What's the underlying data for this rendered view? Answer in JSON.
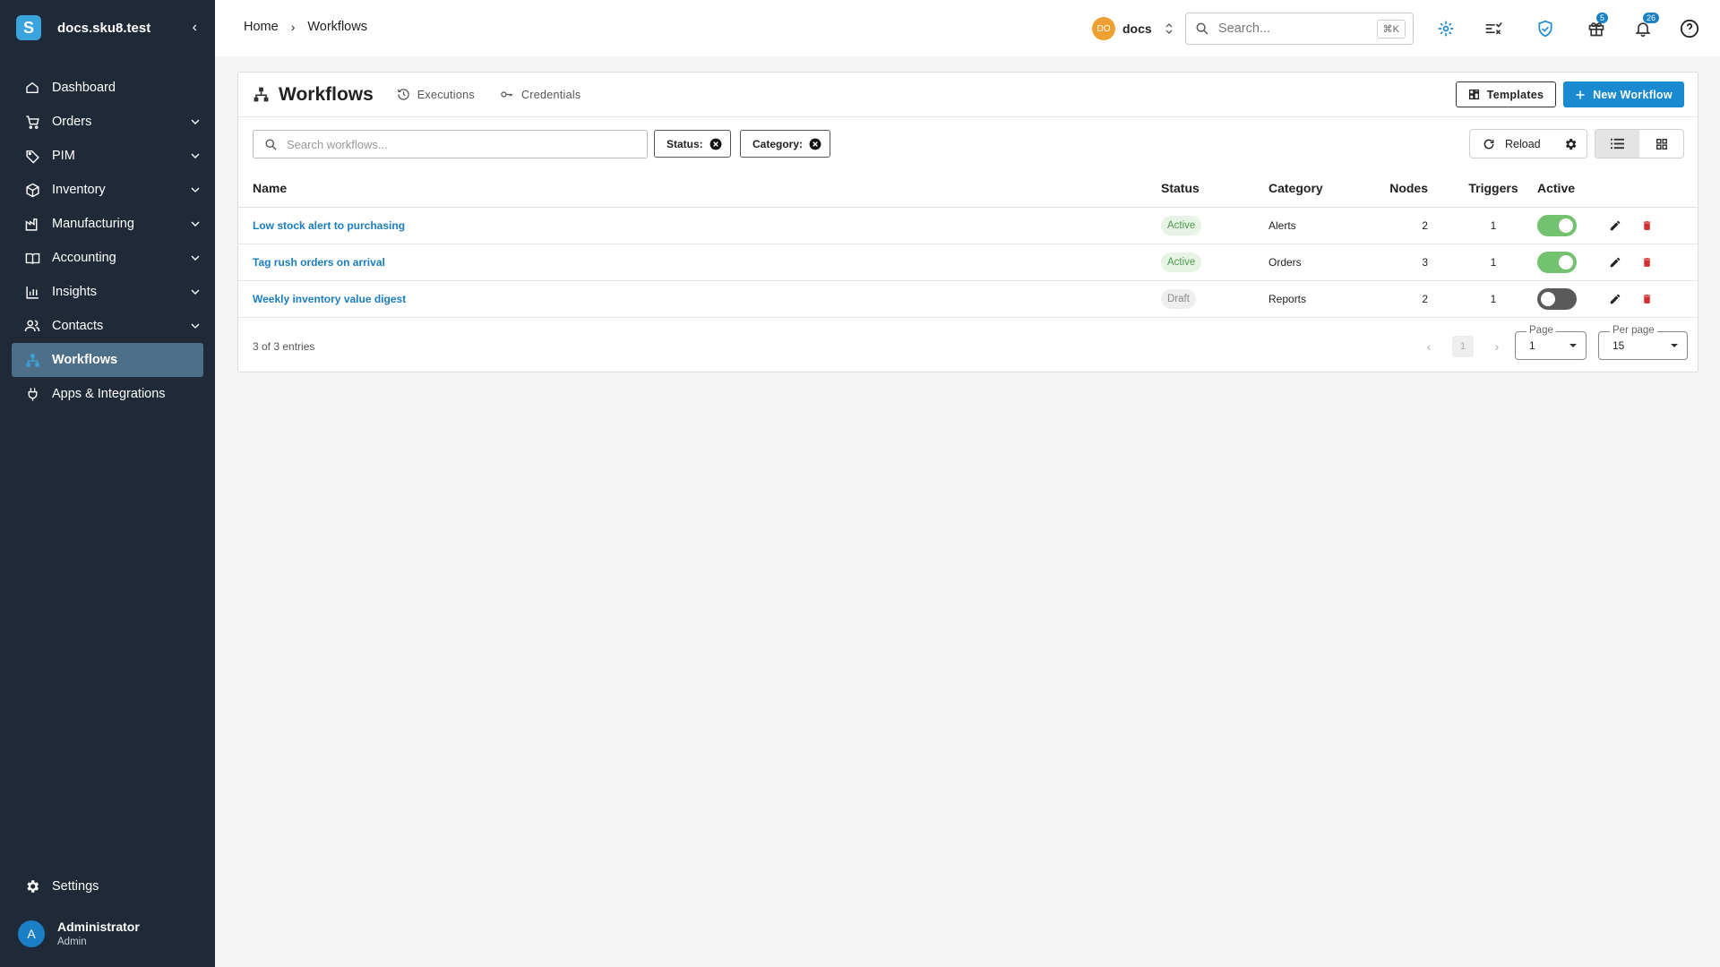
{
  "app": {
    "logo_letter": "S",
    "domain": "docs.sku8.test"
  },
  "sidebar": {
    "items": [
      {
        "label": "Dashboard",
        "icon": "home-icon",
        "expandable": false
      },
      {
        "label": "Orders",
        "icon": "cart-icon",
        "expandable": true
      },
      {
        "label": "PIM",
        "icon": "tag-icon",
        "expandable": true
      },
      {
        "label": "Inventory",
        "icon": "box-icon",
        "expandable": true
      },
      {
        "label": "Manufacturing",
        "icon": "factory-icon",
        "expandable": true
      },
      {
        "label": "Accounting",
        "icon": "book-icon",
        "expandable": true
      },
      {
        "label": "Insights",
        "icon": "bar-chart-icon",
        "expandable": true
      },
      {
        "label": "Contacts",
        "icon": "people-icon",
        "expandable": true
      },
      {
        "label": "Workflows",
        "icon": "workflow-icon",
        "expandable": false,
        "active": true
      },
      {
        "label": "Apps & Integrations",
        "icon": "plug-icon",
        "expandable": false
      }
    ],
    "settings_label": "Settings",
    "user": {
      "initial": "A",
      "name": "Administrator",
      "role": "Admin"
    }
  },
  "topbar": {
    "breadcrumbs": [
      "Home",
      "Workflows"
    ],
    "org": {
      "initials": "DO",
      "name": "docs"
    },
    "search": {
      "placeholder": "Search...",
      "shortcut": "⌘K"
    },
    "gift_count": "5",
    "notification_count": "26"
  },
  "page": {
    "title": "Workflows",
    "tabs": [
      "Executions",
      "Credentials"
    ],
    "templates_label": "Templates",
    "new_workflow_label": "New Workflow",
    "search_placeholder": "Search workflows...",
    "filters": [
      "Status:",
      "Category:"
    ],
    "reload_label": "Reload"
  },
  "table": {
    "columns": [
      "Name",
      "Status",
      "Category",
      "Nodes",
      "Triggers",
      "Active"
    ],
    "rows": [
      {
        "name": "Low stock alert to purchasing",
        "status": "Active",
        "category": "Alerts",
        "nodes": "2",
        "triggers": "1",
        "active": true
      },
      {
        "name": "Tag rush orders on arrival",
        "status": "Active",
        "category": "Orders",
        "nodes": "3",
        "triggers": "1",
        "active": true
      },
      {
        "name": "Weekly inventory value digest",
        "status": "Draft",
        "category": "Reports",
        "nodes": "2",
        "triggers": "1",
        "active": false
      }
    ]
  },
  "footer": {
    "entries": "3 of 3 entries",
    "current_page": "1",
    "page_label": "Page",
    "page_value": "1",
    "per_page_label": "Per page",
    "per_page_value": "15"
  },
  "colors": {
    "sidebar_bg": "#1f2937",
    "accent": "#1a8ad1",
    "active_nav": "#4d6f87",
    "success": "#73c26f",
    "danger": "#d32f2f"
  }
}
